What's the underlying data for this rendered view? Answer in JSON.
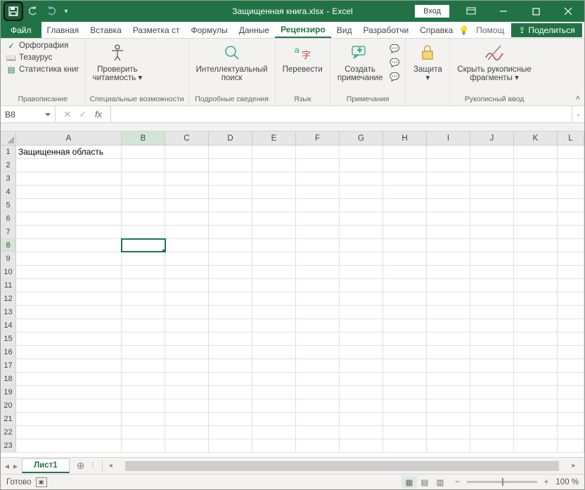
{
  "title": {
    "filename": "Защищенная книга.xlsx",
    "sep": "-",
    "app": "Excel"
  },
  "login": "Вход",
  "tabs": {
    "file": "Файл",
    "items": [
      "Главная",
      "Вставка",
      "Разметка ст",
      "Формулы",
      "Данные",
      "Рецензиро",
      "Вид",
      "Разработчи",
      "Справка"
    ],
    "active_index": 5,
    "help": "Помощ",
    "share": "Поделиться"
  },
  "ribbon": {
    "g0": {
      "label": "Правописание",
      "b0": "Орфография",
      "b1": "Тезаурус",
      "b2": "Статистика книг"
    },
    "g1": {
      "label": "Специальные возможности",
      "b0_l1": "Проверить",
      "b0_l2": "читаемость"
    },
    "g2": {
      "label": "Подробные сведения",
      "b0_l1": "Интеллектуальный",
      "b0_l2": "поиск"
    },
    "g3": {
      "label": "Язык",
      "b0": "Перевести"
    },
    "g4": {
      "label": "Примечания",
      "b0_l1": "Создать",
      "b0_l2": "примечание"
    },
    "g5": {
      "label": "",
      "b0": "Защита"
    },
    "g6": {
      "label": "Рукописный ввод",
      "b0_l1": "Скрыть рукописные",
      "b0_l2": "фрагменты"
    }
  },
  "namebox": "B8",
  "fx": "fx",
  "grid": {
    "cols": [
      "A",
      "B",
      "C",
      "D",
      "E",
      "F",
      "G",
      "H",
      "I",
      "J",
      "K",
      "L"
    ],
    "row_count": 23,
    "active_col": "B",
    "active_row": 8,
    "cells": {
      "A1": "Защищенная область"
    }
  },
  "sheet": {
    "name": "Лист1"
  },
  "status": {
    "ready": "Готово",
    "zoom": "100 %"
  }
}
